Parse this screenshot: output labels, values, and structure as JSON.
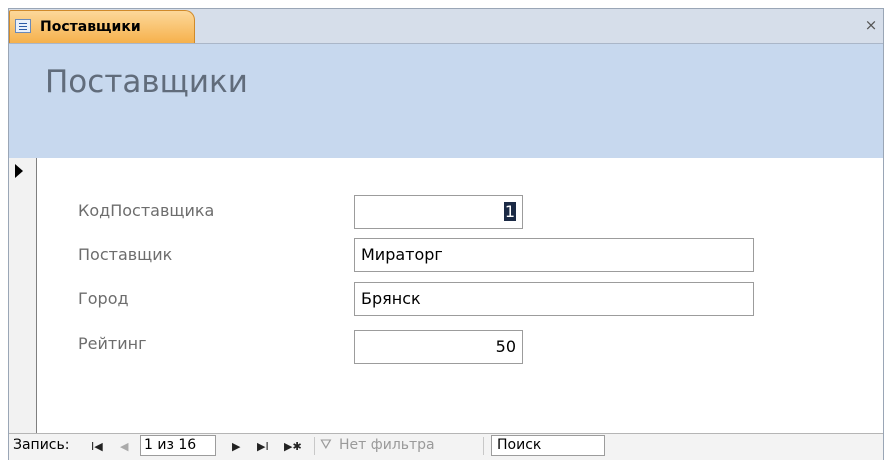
{
  "tab": {
    "label": "Поставщики",
    "icon": "form-icon"
  },
  "close_label": "×",
  "header": {
    "title": "Поставщики"
  },
  "fields": [
    {
      "label": "КодПоставщика",
      "value": "1"
    },
    {
      "label": "Поставщик",
      "value": "Мираторг"
    },
    {
      "label": "Город",
      "value": "Брянск"
    },
    {
      "label": "Рейтинг",
      "value": "50"
    }
  ],
  "navbar": {
    "record_label": "Запись:",
    "first_glyph": "I◀",
    "prev_glyph": "◀",
    "record_position": "1 из 16",
    "next_glyph": "▶",
    "last_glyph": "▶I",
    "new_glyph": "▶✱",
    "filter_icon": "funnel-icon",
    "filter_glyph": "⛛",
    "filter_label": "Нет фильтра",
    "search_label": "Поиск"
  },
  "colors": {
    "tab": "#f6b14c",
    "header": "#c7d8ee",
    "title": "#616c7b"
  }
}
